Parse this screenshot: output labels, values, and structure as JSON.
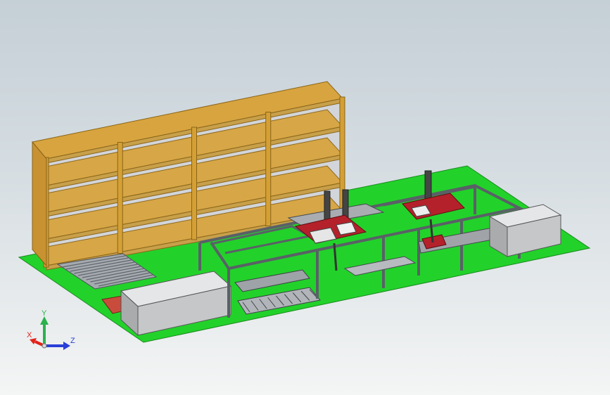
{
  "viewport": {
    "background_top": "#c5cfd6",
    "background_bottom": "#f4f5f5"
  },
  "model": {
    "floor_color": "#22d22a",
    "shelf_frame_color": "#d3a23a",
    "shelf_board_color": "#c8cbd1",
    "conveyor_frame_color": "#6b7178",
    "gripper_color": "#b4212b",
    "cabinet_color": "#c9cbcd",
    "shelving": {
      "bays": 4,
      "levels": 4
    },
    "gantry_robots": 2
  },
  "triad": {
    "x_label": "X",
    "y_label": "Y",
    "z_label": "Z",
    "x_color": "#e2231a",
    "y_color": "#2bb24c",
    "z_color": "#2a3fd8"
  }
}
